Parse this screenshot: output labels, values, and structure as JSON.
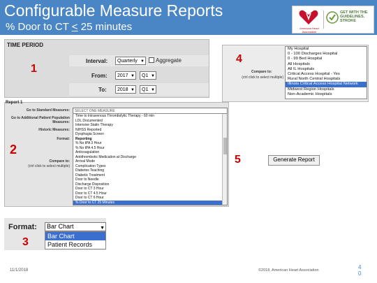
{
  "header": {
    "title": "Configurable Measure Reports",
    "subtitle_pre": "% Door to CT ",
    "subtitle_sym": "<",
    "subtitle_post": " 25 minutes"
  },
  "logo": {
    "aha_text": "American Heart Association",
    "gwtg_text": "GET WITH THE GUIDELINES. STROKE"
  },
  "time_period": {
    "heading": "TIME PERIOD",
    "interval_label": "Interval:",
    "interval_value": "Quarterly",
    "aggregate_label": "Aggregate",
    "from_label": "From:",
    "from_year": "2017",
    "from_quarter": "Q1",
    "to_label": "To:",
    "to_year": "2018",
    "to_quarter": "Q1"
  },
  "compare": {
    "label_line1": "Compare to:",
    "label_line2": "(ctrl click to select multiple)",
    "items": [
      "My Hospital",
      "0 - 100 Discharges Hospital",
      "0 - 99 Bed Hospital",
      "All Hospitals",
      "All IL Hospitals",
      "Critical Access Hospital - Yes",
      "Rural North Central Hospitals",
      "Illinois Critical Access Hospital Network",
      "Midwest Region Hospitals",
      "Non-Academic Hospitals"
    ],
    "selected_index": 7
  },
  "measures": {
    "heading": "Report 1",
    "standard_label": "Go to Standard Measures:",
    "additional_label": "Go to Additional Patient Population Measures:",
    "historic_label": "Historic Measures:",
    "format_label": "Format:",
    "compare_label": "Compare to:",
    "compare_hint": "(ctrl click to select multiple)",
    "standard_value": "SELECT ONE MEASURE",
    "list_items": [
      "Time to Intravenous Thrombolytic Therapy - 60 min",
      "LDL Documented",
      "Intensive Statin Therapy",
      "NIHSS Reported",
      "Dysphagia Screen",
      "Reporting",
      "% No tPA 3 Hour",
      "% No tPA 4.5 Hour",
      "Anticoagulation",
      "Antithrombotic Medication at Discharge",
      "Arrival Mode",
      "Complication Types",
      "Diabetes Teaching",
      "Diabetic Treatment",
      "Door to Needle",
      "Discharge Disposition",
      "Door to CT 3 Hour",
      "Door to CT 4.5 Hour",
      "Door to CT 6 Hour",
      "% Door to CT 25 Minutes"
    ],
    "bold_index": 5,
    "selected_index": 19
  },
  "generate": {
    "label": "Generate Report"
  },
  "format_zoom": {
    "label": "Format:",
    "value": "Bar Chart",
    "options": [
      "Bar Chart",
      "Patient Records"
    ],
    "highlighted_index": 0
  },
  "markers": {
    "m1": "1",
    "m2": "2",
    "m3": "3",
    "m4": "4",
    "m5": "5"
  },
  "footer": {
    "date": "11/1/2018",
    "copyright": "©2018, American Heart Association",
    "page_line1": "4",
    "page_line2": "0"
  },
  "colors": {
    "header_bg": "#4a86c6",
    "selected_bg": "#3a6fd0",
    "marker": "#cc0000"
  }
}
